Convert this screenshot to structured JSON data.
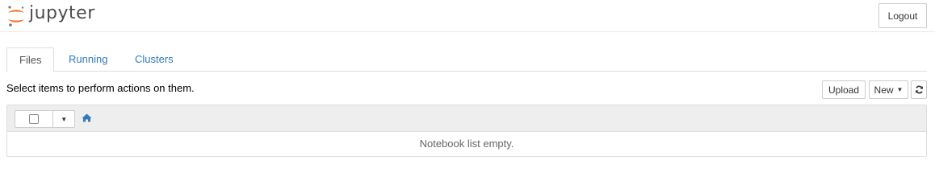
{
  "header": {
    "logo_text": "jupyter",
    "logout_label": "Logout"
  },
  "tabs": [
    {
      "label": "Files",
      "active": true
    },
    {
      "label": "Running",
      "active": false
    },
    {
      "label": "Clusters",
      "active": false
    }
  ],
  "toolbar": {
    "instructions": "Select items to perform actions on them.",
    "upload_label": "Upload",
    "new_label": "New",
    "refresh_icon": "refresh-icon"
  },
  "file_list": {
    "select_all_checked": false,
    "breadcrumb_icon": "home-icon",
    "empty_message": "Notebook list empty."
  },
  "colors": {
    "link": "#337ab7",
    "logo_orange": "#f37726",
    "header_bar": "#eeeeee"
  }
}
